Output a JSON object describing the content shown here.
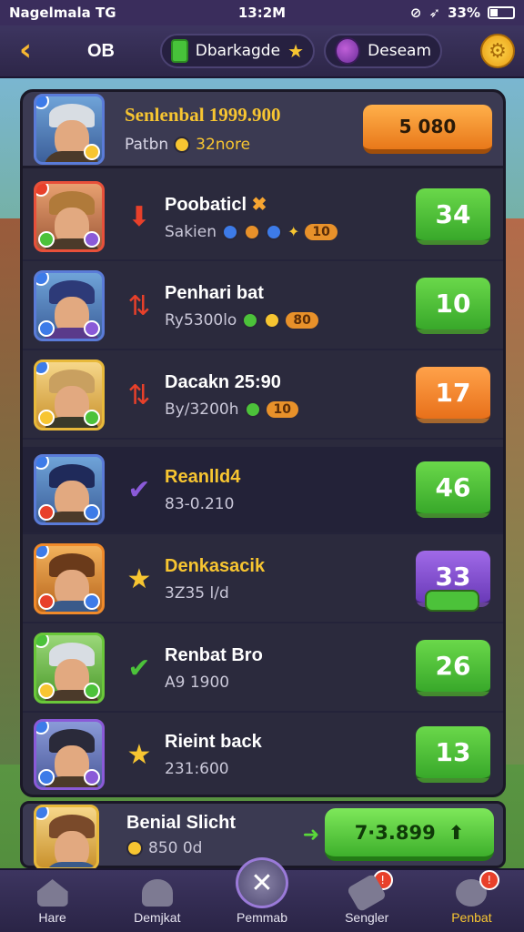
{
  "status_bar": {
    "carrier": "Nagelmala  TG",
    "time": "13:2M",
    "battery": "33%"
  },
  "top_bar": {
    "title": "OB",
    "pill_1_label": "Dbarkagde",
    "pill_2_label": "Deseam"
  },
  "header": {
    "name": "Senlenbal 1999.900",
    "sub_label": "Patbn",
    "sub_amount": "32nore",
    "button_label": "5 080"
  },
  "players": [
    {
      "name": "Poobaticl",
      "sub": "Sakien",
      "tag": "10",
      "score": "34",
      "score_color": "green",
      "rank_icon": "down-arrow-red",
      "avatar": "av-red"
    },
    {
      "name": "Penhari bat",
      "sub": "Ry5300lo",
      "tag": "80",
      "score": "10",
      "score_color": "green",
      "rank_icon": "arrows-mixed",
      "avatar": "av-blue"
    },
    {
      "name": "Dacakn 25:90",
      "sub": "By/3200h",
      "tag": "10",
      "score": "17",
      "score_color": "orange",
      "rank_icon": "arrows-mixed",
      "avatar": "av-gold"
    },
    {
      "name": "Reanlld4",
      "sub": "83-0.210",
      "tag": "",
      "score": "46",
      "score_color": "green",
      "rank_icon": "check-purple",
      "avatar": "av-blue"
    },
    {
      "name": "Denkasacik",
      "sub": "3Z35 l/d",
      "tag": "",
      "score": "33",
      "score_color": "purple",
      "rank_icon": "star-gold",
      "avatar": "av-orange"
    },
    {
      "name": "Renbat Bro",
      "sub": "A9 1900",
      "tag": "",
      "score": "26",
      "score_color": "green",
      "rank_icon": "check-green",
      "avatar": "av-green"
    },
    {
      "name": "Rieint back",
      "sub": "231:600",
      "tag": "",
      "score": "13",
      "score_color": "green",
      "rank_icon": "star-gold",
      "avatar": "av-purple"
    }
  ],
  "self_row": {
    "name": "Benial Slicht",
    "sub": "850 0d",
    "button_label": "7·3.899"
  },
  "nav": [
    {
      "label": "Hare",
      "icon": "home-icon",
      "badge": ""
    },
    {
      "label": "Demjkat",
      "icon": "person-icon",
      "badge": ""
    },
    {
      "label": "Pemmab",
      "icon": "close-icon",
      "badge": ""
    },
    {
      "label": "Sengler",
      "icon": "tools-icon",
      "badge": "!"
    },
    {
      "label": "Penbat",
      "icon": "chat-icon",
      "badge": "!"
    }
  ]
}
